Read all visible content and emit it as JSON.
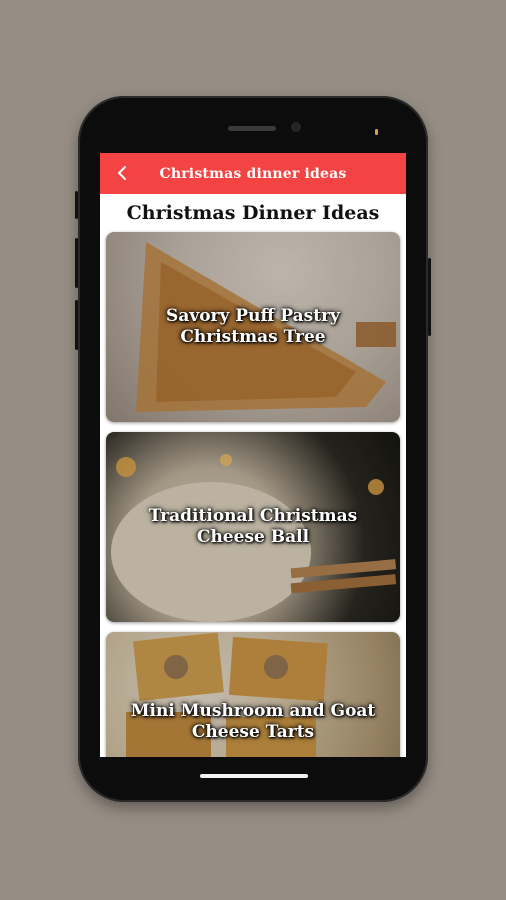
{
  "appbar": {
    "back_icon": "arrow-left-icon",
    "title": "Christmas dinner ideas"
  },
  "page": {
    "heading": "Christmas Dinner Ideas"
  },
  "cards": [
    {
      "label": "Savory Puff Pastry Christmas Tree"
    },
    {
      "label": "Traditional Christmas Cheese Ball"
    },
    {
      "label": "Mini Mushroom and Goat Cheese Tarts"
    }
  ],
  "colors": {
    "appbar": "#f44343",
    "backdrop": "#968e84"
  }
}
